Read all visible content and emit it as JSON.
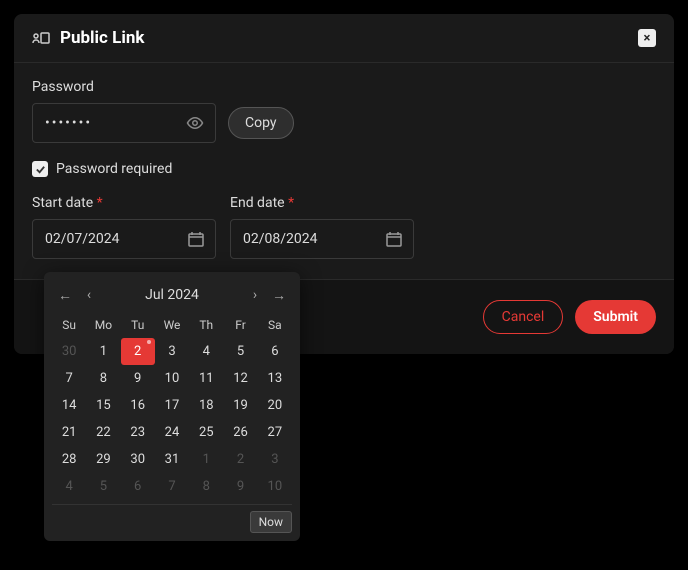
{
  "modal": {
    "title": "Public Link",
    "close_icon": "×"
  },
  "password": {
    "label": "Password",
    "value": "•••••••",
    "copy_label": "Copy",
    "eye_icon": "eye-icon"
  },
  "password_required": {
    "checked": true,
    "label": "Password required"
  },
  "start_date": {
    "label": "Start date",
    "required": "*",
    "value": "02/07/2024"
  },
  "end_date": {
    "label": "End date",
    "required": "*",
    "value": "02/08/2024"
  },
  "footer": {
    "cancel": "Cancel",
    "submit": "Submit"
  },
  "calendar": {
    "month_label": "Jul 2024",
    "now_label": "Now",
    "dow": [
      "Su",
      "Mo",
      "Tu",
      "We",
      "Th",
      "Fr",
      "Sa"
    ],
    "weeks": [
      [
        {
          "d": "30",
          "muted": true
        },
        {
          "d": "1"
        },
        {
          "d": "2",
          "selected": true
        },
        {
          "d": "3"
        },
        {
          "d": "4"
        },
        {
          "d": "5"
        },
        {
          "d": "6"
        }
      ],
      [
        {
          "d": "7"
        },
        {
          "d": "8"
        },
        {
          "d": "9"
        },
        {
          "d": "10"
        },
        {
          "d": "11"
        },
        {
          "d": "12"
        },
        {
          "d": "13"
        }
      ],
      [
        {
          "d": "14"
        },
        {
          "d": "15"
        },
        {
          "d": "16"
        },
        {
          "d": "17"
        },
        {
          "d": "18"
        },
        {
          "d": "19"
        },
        {
          "d": "20"
        }
      ],
      [
        {
          "d": "21"
        },
        {
          "d": "22"
        },
        {
          "d": "23"
        },
        {
          "d": "24"
        },
        {
          "d": "25"
        },
        {
          "d": "26"
        },
        {
          "d": "27"
        }
      ],
      [
        {
          "d": "28"
        },
        {
          "d": "29"
        },
        {
          "d": "30"
        },
        {
          "d": "31"
        },
        {
          "d": "1",
          "muted": true
        },
        {
          "d": "2",
          "muted": true
        },
        {
          "d": "3",
          "muted": true
        }
      ],
      [
        {
          "d": "4",
          "muted": true
        },
        {
          "d": "5",
          "muted": true
        },
        {
          "d": "6",
          "muted": true
        },
        {
          "d": "7",
          "muted": true
        },
        {
          "d": "8",
          "muted": true
        },
        {
          "d": "9",
          "muted": true
        },
        {
          "d": "10",
          "muted": true
        }
      ]
    ]
  }
}
